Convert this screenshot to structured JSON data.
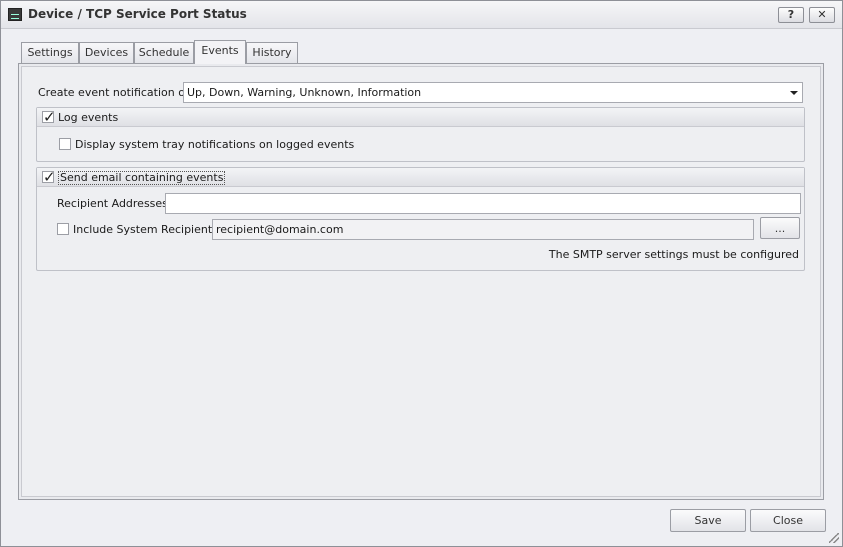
{
  "window": {
    "title": "Device / TCP Service Port Status",
    "help_label": "?",
    "close_label": "✕"
  },
  "tabs": [
    {
      "label": "Settings",
      "active": false
    },
    {
      "label": "Devices",
      "active": false
    },
    {
      "label": "Schedule",
      "active": false
    },
    {
      "label": "Events",
      "active": true
    },
    {
      "label": "History",
      "active": false
    }
  ],
  "events": {
    "create_label": "Create event notification on:",
    "create_value": "Up, Down, Warning, Unknown, Information",
    "log_events": {
      "label": "Log events",
      "checked": true,
      "tray_label": "Display system tray notifications on logged events",
      "tray_checked": false
    },
    "email": {
      "label": "Send email containing events",
      "checked": true,
      "recipient_label": "Recipient Addresses:",
      "recipient_value": "",
      "include_label": "Include System Recipients:",
      "include_checked": false,
      "system_recipients_value": "recipient@domain.com",
      "browse_label": "...",
      "smtp_note": "The SMTP server settings must be configured"
    }
  },
  "footer": {
    "save_label": "Save",
    "close_label": "Close"
  },
  "icons": {
    "app": "device-monitor-icon",
    "check": "✓"
  }
}
